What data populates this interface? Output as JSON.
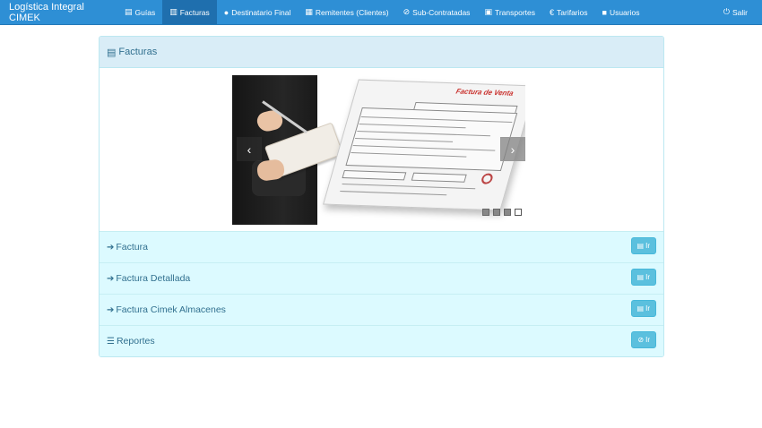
{
  "navbar": {
    "brand": "Logística Integral CIMEK",
    "items": [
      {
        "label": "Guías",
        "icon": "list-icon"
      },
      {
        "label": "Facturas",
        "icon": "book-icon",
        "active": true
      },
      {
        "label": "Destinatario Final",
        "icon": "user-icon"
      },
      {
        "label": "Remitentes (Clientes)",
        "icon": "grid-icon"
      },
      {
        "label": "Sub-Contratadas",
        "icon": "paperclip-icon"
      },
      {
        "label": "Transportes",
        "icon": "bus-icon"
      },
      {
        "label": "Tarifarios",
        "icon": "euro-icon"
      },
      {
        "label": "Usuarios",
        "icon": "lock-icon"
      }
    ],
    "exit_label": "Salir"
  },
  "panel": {
    "title": "Facturas",
    "carousel": {
      "invoice_title": "Factura de Venta",
      "slides_count": 4,
      "active_slide": 4
    },
    "items": [
      {
        "label": "Factura",
        "icon": "log-in-icon",
        "button": "Ir",
        "button_icon": "list-alt-icon"
      },
      {
        "label": "Factura Detallada",
        "icon": "log-in-icon",
        "button": "Ir",
        "button_icon": "list-alt-icon"
      },
      {
        "label": "Factura Cimek Almacenes",
        "icon": "log-in-icon",
        "button": "Ir",
        "button_icon": "list-alt-icon"
      },
      {
        "label": "Reportes",
        "icon": "tasks-icon",
        "button": "Ir",
        "button_icon": "paperclip-icon"
      }
    ]
  },
  "colors": {
    "navbar": "#2e8fd5",
    "navbar_active": "#1f6fae",
    "panel_heading": "#d9edf7",
    "list_item_bg": "#dcfaff",
    "button_info": "#5bc0de",
    "text_info": "#31708f"
  }
}
